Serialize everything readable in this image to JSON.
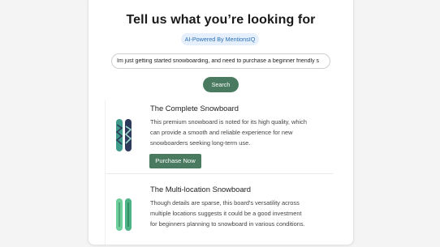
{
  "header": {
    "title": "Tell us what you’re looking for",
    "badge": "AI-Powered By MentionsIQ"
  },
  "search": {
    "value": "Im just getting started snowboarding, and need to purchase a beginner friendly s",
    "button_label": "Search"
  },
  "results": [
    {
      "title": "The Complete Snowboard",
      "description_lines": [
        "This premium snowboard is noted for its high quality, which",
        "can provide a smooth and reliable experience for new",
        "snowboarders seeking long-term use."
      ],
      "button_label": "Purchase Now",
      "image_icon": "snowboard-pair-icon",
      "colors": [
        "#3f9b8c",
        "#2d3a5a"
      ]
    },
    {
      "title": "The Multi-location Snowboard",
      "description_lines": [
        "Though details are sparse, this board's versatility across",
        "multiple locations suggests it could be a good investment",
        "for beginners planning to snowboard in various conditions."
      ],
      "image_icon": "snowboard-pair-icon",
      "colors": [
        "#6fcf9a",
        "#4db386"
      ]
    }
  ],
  "colors": {
    "accent": "#4a7b60",
    "badge_bg": "#e5f0fc",
    "badge_text": "#2a6fb8"
  }
}
